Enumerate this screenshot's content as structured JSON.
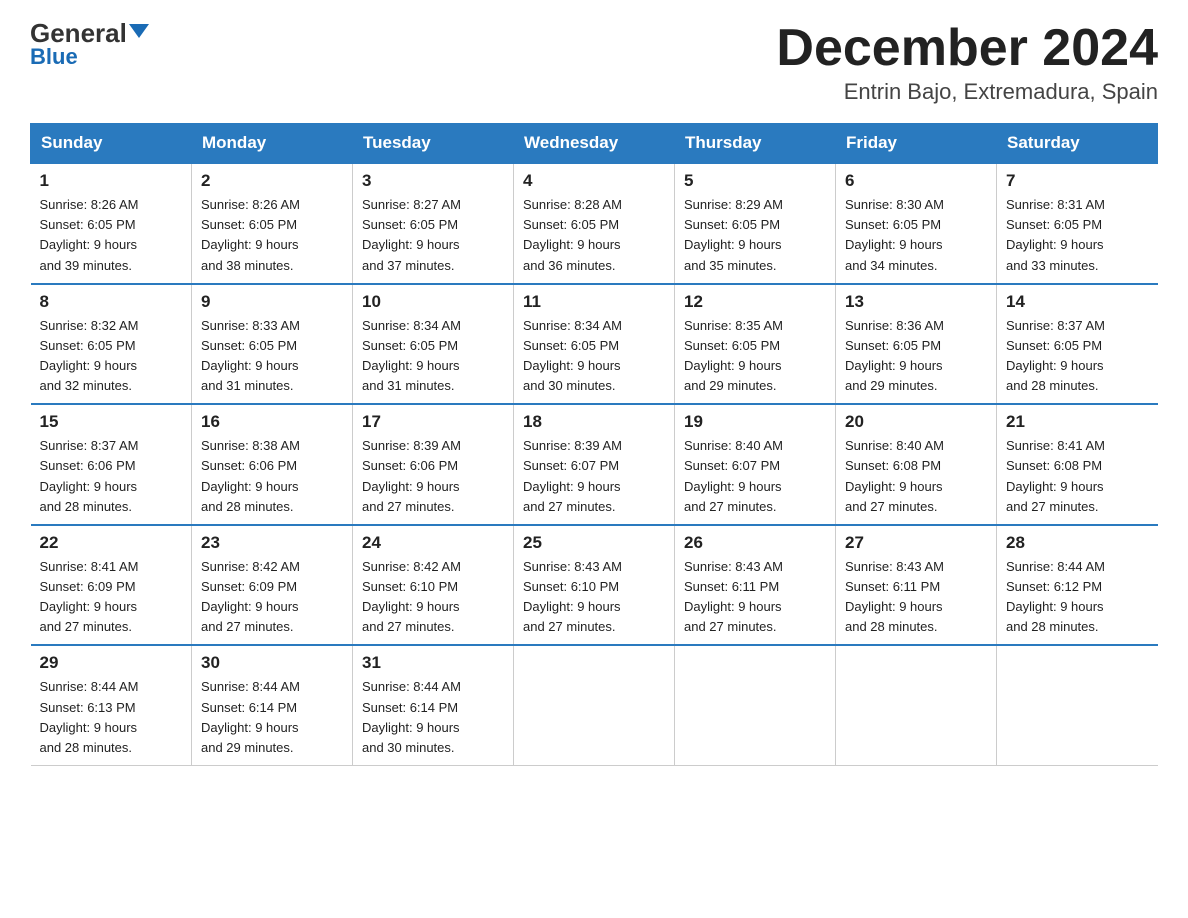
{
  "logo": {
    "general": "General",
    "blue": "Blue"
  },
  "title": "December 2024",
  "subtitle": "Entrin Bajo, Extremadura, Spain",
  "days_of_week": [
    "Sunday",
    "Monday",
    "Tuesday",
    "Wednesday",
    "Thursday",
    "Friday",
    "Saturday"
  ],
  "weeks": [
    [
      {
        "day": 1,
        "sunrise": "8:26 AM",
        "sunset": "6:05 PM",
        "daylight": "9 hours and 39 minutes."
      },
      {
        "day": 2,
        "sunrise": "8:26 AM",
        "sunset": "6:05 PM",
        "daylight": "9 hours and 38 minutes."
      },
      {
        "day": 3,
        "sunrise": "8:27 AM",
        "sunset": "6:05 PM",
        "daylight": "9 hours and 37 minutes."
      },
      {
        "day": 4,
        "sunrise": "8:28 AM",
        "sunset": "6:05 PM",
        "daylight": "9 hours and 36 minutes."
      },
      {
        "day": 5,
        "sunrise": "8:29 AM",
        "sunset": "6:05 PM",
        "daylight": "9 hours and 35 minutes."
      },
      {
        "day": 6,
        "sunrise": "8:30 AM",
        "sunset": "6:05 PM",
        "daylight": "9 hours and 34 minutes."
      },
      {
        "day": 7,
        "sunrise": "8:31 AM",
        "sunset": "6:05 PM",
        "daylight": "9 hours and 33 minutes."
      }
    ],
    [
      {
        "day": 8,
        "sunrise": "8:32 AM",
        "sunset": "6:05 PM",
        "daylight": "9 hours and 32 minutes."
      },
      {
        "day": 9,
        "sunrise": "8:33 AM",
        "sunset": "6:05 PM",
        "daylight": "9 hours and 31 minutes."
      },
      {
        "day": 10,
        "sunrise": "8:34 AM",
        "sunset": "6:05 PM",
        "daylight": "9 hours and 31 minutes."
      },
      {
        "day": 11,
        "sunrise": "8:34 AM",
        "sunset": "6:05 PM",
        "daylight": "9 hours and 30 minutes."
      },
      {
        "day": 12,
        "sunrise": "8:35 AM",
        "sunset": "6:05 PM",
        "daylight": "9 hours and 29 minutes."
      },
      {
        "day": 13,
        "sunrise": "8:36 AM",
        "sunset": "6:05 PM",
        "daylight": "9 hours and 29 minutes."
      },
      {
        "day": 14,
        "sunrise": "8:37 AM",
        "sunset": "6:05 PM",
        "daylight": "9 hours and 28 minutes."
      }
    ],
    [
      {
        "day": 15,
        "sunrise": "8:37 AM",
        "sunset": "6:06 PM",
        "daylight": "9 hours and 28 minutes."
      },
      {
        "day": 16,
        "sunrise": "8:38 AM",
        "sunset": "6:06 PM",
        "daylight": "9 hours and 28 minutes."
      },
      {
        "day": 17,
        "sunrise": "8:39 AM",
        "sunset": "6:06 PM",
        "daylight": "9 hours and 27 minutes."
      },
      {
        "day": 18,
        "sunrise": "8:39 AM",
        "sunset": "6:07 PM",
        "daylight": "9 hours and 27 minutes."
      },
      {
        "day": 19,
        "sunrise": "8:40 AM",
        "sunset": "6:07 PM",
        "daylight": "9 hours and 27 minutes."
      },
      {
        "day": 20,
        "sunrise": "8:40 AM",
        "sunset": "6:08 PM",
        "daylight": "9 hours and 27 minutes."
      },
      {
        "day": 21,
        "sunrise": "8:41 AM",
        "sunset": "6:08 PM",
        "daylight": "9 hours and 27 minutes."
      }
    ],
    [
      {
        "day": 22,
        "sunrise": "8:41 AM",
        "sunset": "6:09 PM",
        "daylight": "9 hours and 27 minutes."
      },
      {
        "day": 23,
        "sunrise": "8:42 AM",
        "sunset": "6:09 PM",
        "daylight": "9 hours and 27 minutes."
      },
      {
        "day": 24,
        "sunrise": "8:42 AM",
        "sunset": "6:10 PM",
        "daylight": "9 hours and 27 minutes."
      },
      {
        "day": 25,
        "sunrise": "8:43 AM",
        "sunset": "6:10 PM",
        "daylight": "9 hours and 27 minutes."
      },
      {
        "day": 26,
        "sunrise": "8:43 AM",
        "sunset": "6:11 PM",
        "daylight": "9 hours and 27 minutes."
      },
      {
        "day": 27,
        "sunrise": "8:43 AM",
        "sunset": "6:11 PM",
        "daylight": "9 hours and 28 minutes."
      },
      {
        "day": 28,
        "sunrise": "8:44 AM",
        "sunset": "6:12 PM",
        "daylight": "9 hours and 28 minutes."
      }
    ],
    [
      {
        "day": 29,
        "sunrise": "8:44 AM",
        "sunset": "6:13 PM",
        "daylight": "9 hours and 28 minutes."
      },
      {
        "day": 30,
        "sunrise": "8:44 AM",
        "sunset": "6:14 PM",
        "daylight": "9 hours and 29 minutes."
      },
      {
        "day": 31,
        "sunrise": "8:44 AM",
        "sunset": "6:14 PM",
        "daylight": "9 hours and 30 minutes."
      },
      null,
      null,
      null,
      null
    ]
  ]
}
